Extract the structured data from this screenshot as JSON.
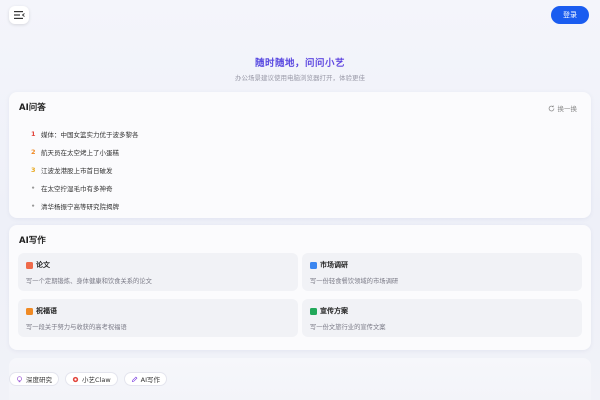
{
  "header": {
    "login_label": "登录"
  },
  "hero": {
    "title": "随时随地，问问小艺",
    "subtitle": "办公场景建议使用电脑浏览器打开，体验更佳"
  },
  "qa": {
    "title": "AI问答",
    "refresh_label": "换一换",
    "items": [
      {
        "num": "1",
        "text": "媒体：中国女篮实力优于波多黎各"
      },
      {
        "num": "2",
        "text": "航天员在太空烤上了小蛋糕"
      },
      {
        "num": "3",
        "text": "江波龙港股上市首日破发"
      },
      {
        "num": "•",
        "text": "在太空拧湿毛巾有多神奇"
      },
      {
        "num": "•",
        "text": "清华杨振宁高等研究院揭牌"
      }
    ]
  },
  "write": {
    "title": "AI写作",
    "tiles": [
      {
        "name": "论文",
        "desc": "写一个定期锻炼、身体健康和饮食关系的论文",
        "icon": "paper-icon",
        "color": "#ef6a4a"
      },
      {
        "name": "市场调研",
        "desc": "写一份轻食餐饮领域的市场调研",
        "icon": "doc-icon",
        "color": "#3b86f0"
      },
      {
        "name": "祝福语",
        "desc": "写一段关于努力与收获的高考祝福语",
        "icon": "note-icon",
        "color": "#f08a24"
      },
      {
        "name": "宣传方案",
        "desc": "写一份文旅行业的宣传文案",
        "icon": "doc-icon",
        "color": "#22a85a"
      }
    ]
  },
  "chips": [
    {
      "label": "深度研究",
      "icon": "bulb-icon",
      "color": "#9b59d6"
    },
    {
      "label": "小艺Claw",
      "icon": "claw-icon",
      "color": "#e2453c"
    },
    {
      "label": "AI写作",
      "icon": "pen-icon",
      "color": "#7b3fe0"
    }
  ]
}
